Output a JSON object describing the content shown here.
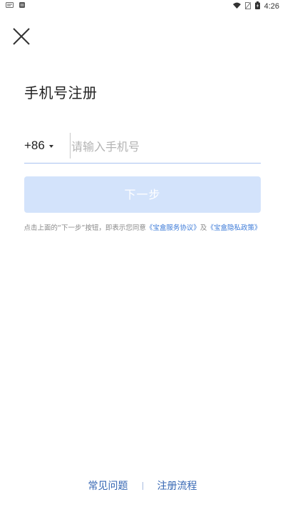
{
  "status_bar": {
    "time": "4:26",
    "battery_icon": "battery-charging-icon",
    "wifi_icon": "wifi-icon",
    "sim_icon": "no-sim-icon"
  },
  "header": {
    "close_icon": "close-icon",
    "title": "手机号注册"
  },
  "phone_form": {
    "country_code": "+86",
    "phone_value": "",
    "phone_placeholder": "请输入手机号",
    "underline_color": "#a9c2f0"
  },
  "next_button": {
    "label": "下一步",
    "background": "#d3e3fb",
    "state": "disabled"
  },
  "agreement": {
    "prefix": "点击上面的“下一步”按钮，即表示您同意",
    "service_link": "《宝盒服务协议》",
    "conjunction": "及",
    "privacy_link": "《宝盒隐私政策》",
    "link_color": "#3d7bd8"
  },
  "footer": {
    "faq_label": "常见问题",
    "flow_label": "注册流程",
    "link_color": "#3566b3"
  }
}
